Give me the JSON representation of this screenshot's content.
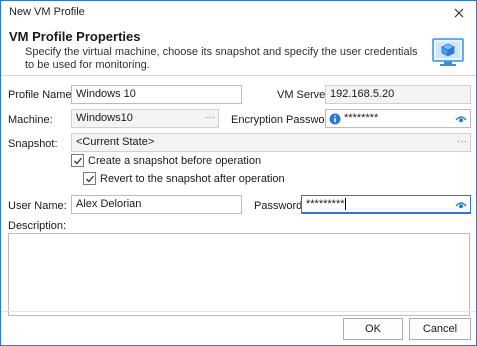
{
  "window": {
    "title": "New VM Profile"
  },
  "header": {
    "title": "VM Profile Properties",
    "description": "Specify the virtual machine, choose its snapshot and specify the user credentials to be used for monitoring."
  },
  "form": {
    "profile_name_label": "Profile Name:",
    "profile_name_value": "Windows 10",
    "vm_server_label": "VM Server:",
    "vm_server_value": "192.168.5.20",
    "machine_label": "Machine:",
    "machine_value": "Windows10",
    "machine_browse": "···",
    "encryption_password_label": "Encryption Password:",
    "encryption_password_value": "********",
    "snapshot_label": "Snapshot:",
    "snapshot_value": "<Current State>",
    "snapshot_browse": "···",
    "create_snapshot_label": "Create a snapshot before operation",
    "create_snapshot_checked": true,
    "revert_snapshot_label": "Revert to the snapshot after operation",
    "revert_snapshot_checked": true,
    "user_name_label": "User Name:",
    "user_name_value": "Alex Delorian",
    "password_label": "Password:",
    "password_value": "*********",
    "description_label": "Description:",
    "description_value": ""
  },
  "buttons": {
    "ok": "OK",
    "cancel": "Cancel"
  },
  "icons": {
    "close": "close-icon",
    "header": "virtual-machine-icon",
    "info": "info-icon",
    "eye": "eye-icon",
    "check": "checkmark-icon"
  },
  "colors": {
    "accent": "#2b79d7",
    "icon_blue": "#3a8ee6",
    "border": "#bcbcbc"
  }
}
